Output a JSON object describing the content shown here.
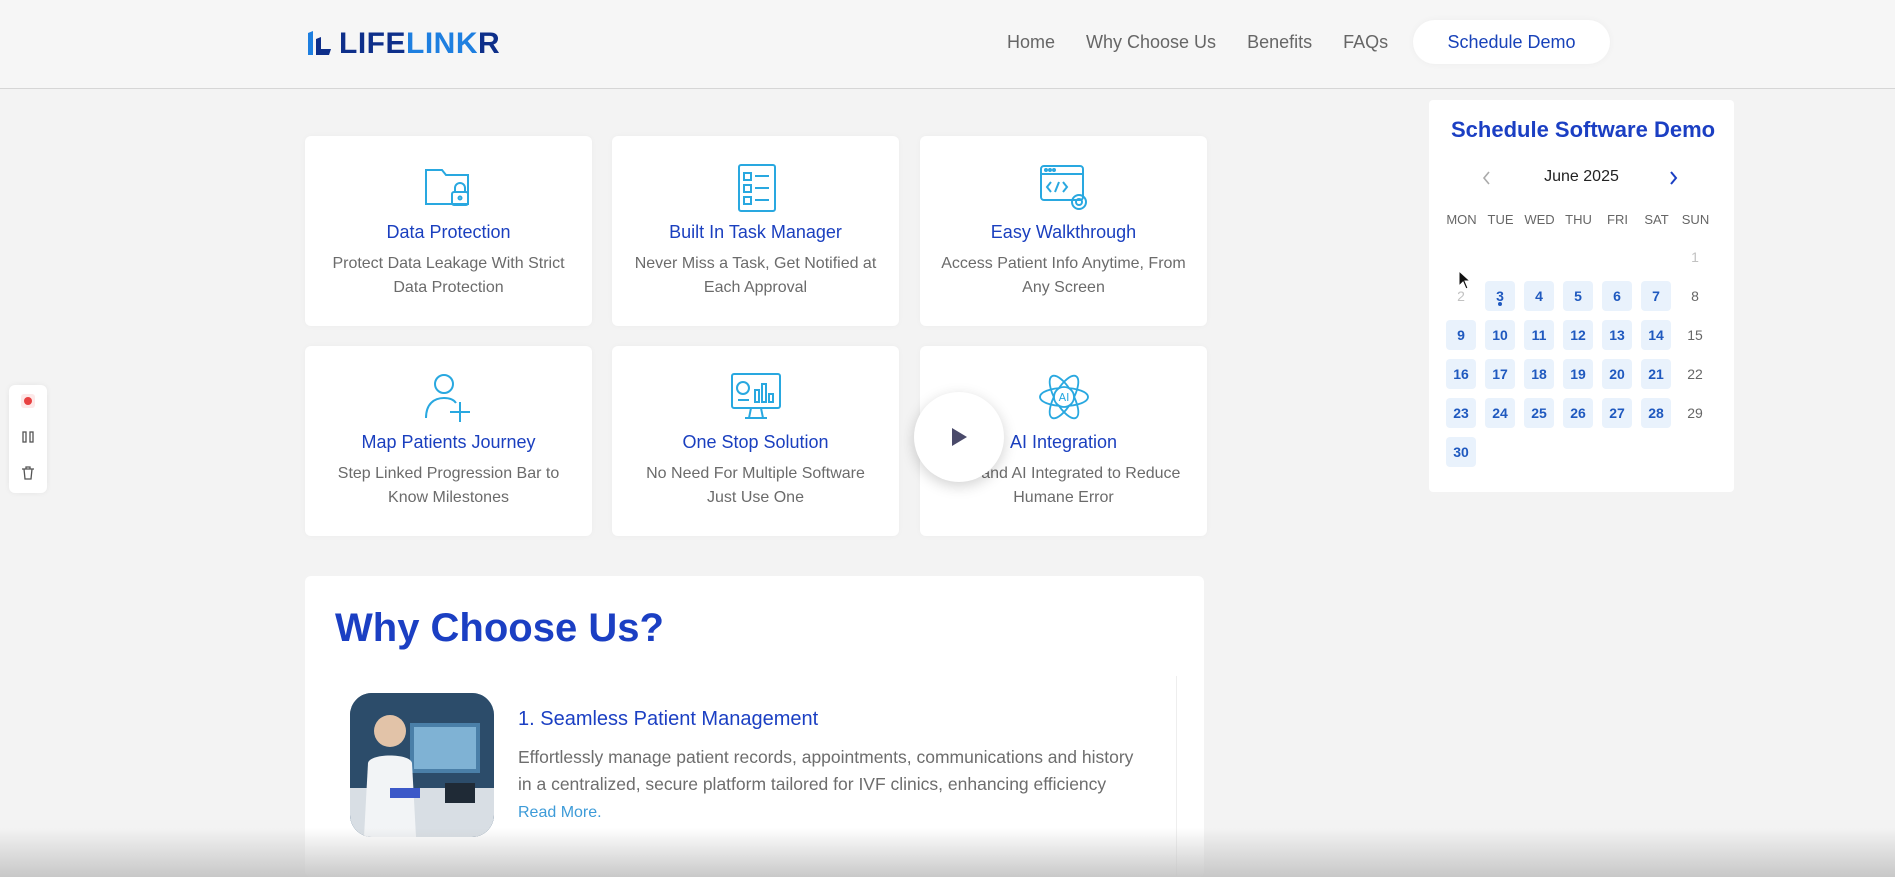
{
  "header": {
    "logo_part1": "LIFE",
    "logo_part2": "LINK",
    "logo_part3": "R",
    "nav": [
      "Home",
      "Why Choose Us",
      "Benefits",
      "FAQs"
    ],
    "cta": "Schedule Demo"
  },
  "features": [
    {
      "icon": "folder-lock-icon",
      "title": "Data Protection",
      "desc": "Protect Data Leakage With Strict Data Protection"
    },
    {
      "icon": "task-list-icon",
      "title": "Built In Task Manager",
      "desc": "Never Miss a Task, Get Notified at Each Approval"
    },
    {
      "icon": "code-settings-icon",
      "title": "Easy Walkthrough",
      "desc": "Access Patient Info Anytime, From Any Screen"
    },
    {
      "icon": "user-add-icon",
      "title": "Map Patients Journey",
      "desc": "Step Linked Progression Bar to Know Milestones"
    },
    {
      "icon": "monitor-chart-icon",
      "title": "One Stop Solution",
      "desc": "No Need For Multiple Software Just Use One"
    },
    {
      "icon": "ai-atom-icon",
      "title": "AI Integration",
      "desc": "TTS and AI Integrated to Reduce Humane Error"
    }
  ],
  "why": {
    "title": "Why Choose Us?",
    "item_title": "1.  Seamless Patient Management",
    "item_desc": "Effortlessly manage patient records, appointments, communications and history in a centralized, secure platform tailored for IVF clinics, enhancing efficiency",
    "read_more": "Read More."
  },
  "calendar": {
    "title": "Schedule Software Demo",
    "month": "June 2025",
    "weekdays": [
      "MON",
      "TUE",
      "WED",
      "THU",
      "FRI",
      "SAT",
      "SUN"
    ],
    "days": [
      {
        "d": "1",
        "state": "muted"
      },
      {
        "d": "2",
        "state": "muted"
      },
      {
        "d": "3",
        "state": "avail",
        "today": true
      },
      {
        "d": "4",
        "state": "avail"
      },
      {
        "d": "5",
        "state": "avail"
      },
      {
        "d": "6",
        "state": "avail"
      },
      {
        "d": "7",
        "state": "avail"
      },
      {
        "d": "8",
        "state": "plain"
      },
      {
        "d": "9",
        "state": "avail"
      },
      {
        "d": "10",
        "state": "avail"
      },
      {
        "d": "11",
        "state": "avail"
      },
      {
        "d": "12",
        "state": "avail"
      },
      {
        "d": "13",
        "state": "avail"
      },
      {
        "d": "14",
        "state": "avail"
      },
      {
        "d": "15",
        "state": "plain"
      },
      {
        "d": "16",
        "state": "avail"
      },
      {
        "d": "17",
        "state": "avail"
      },
      {
        "d": "18",
        "state": "avail"
      },
      {
        "d": "19",
        "state": "avail"
      },
      {
        "d": "20",
        "state": "avail"
      },
      {
        "d": "21",
        "state": "avail"
      },
      {
        "d": "22",
        "state": "plain"
      },
      {
        "d": "23",
        "state": "avail"
      },
      {
        "d": "24",
        "state": "avail"
      },
      {
        "d": "25",
        "state": "avail"
      },
      {
        "d": "26",
        "state": "avail"
      },
      {
        "d": "27",
        "state": "avail"
      },
      {
        "d": "28",
        "state": "avail"
      },
      {
        "d": "29",
        "state": "plain"
      },
      {
        "d": "30",
        "state": "avail"
      }
    ],
    "first_weekday": "SUN"
  },
  "colors": {
    "brand_dark": "#0e2f8a",
    "brand_light": "#1e7fe0",
    "accent": "#1b3fc3",
    "icon": "#29a8e0",
    "record": "#e84141"
  }
}
